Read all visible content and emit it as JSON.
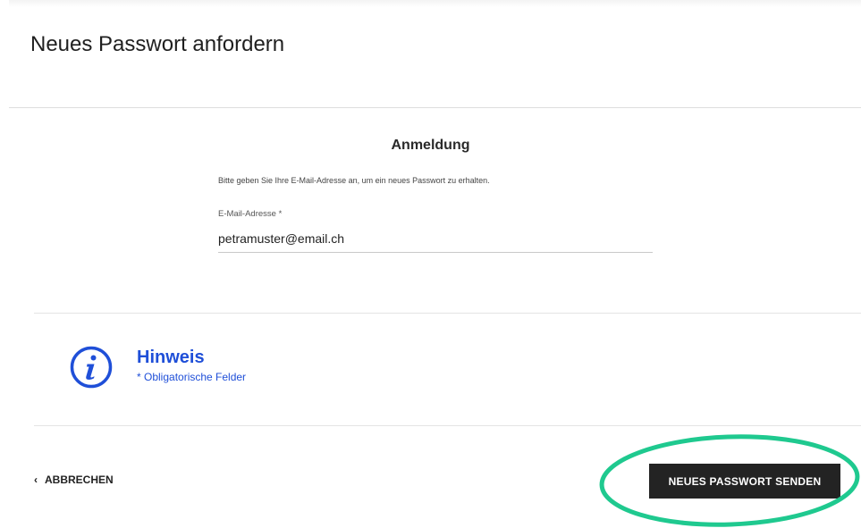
{
  "page": {
    "title": "Neues Passwort anfordern"
  },
  "form": {
    "section_title": "Anmeldung",
    "instruction": "Bitte geben Sie Ihre E-Mail-Adresse an, um ein neues Passwort zu erhalten.",
    "email_label": "E-Mail-Adresse *",
    "email_value": "petramuster@email.ch"
  },
  "hint": {
    "icon": "info-icon",
    "title": "Hinweis",
    "text": "* Obligatorische Felder"
  },
  "footer": {
    "cancel_icon": "chevron-left-icon",
    "cancel_label": "ABBRECHEN",
    "submit_label": "NEUES PASSWORT SENDEN"
  },
  "colors": {
    "accent_blue": "#1f4fd8",
    "button_dark": "#232323",
    "highlight_green": "#1fc98f"
  }
}
